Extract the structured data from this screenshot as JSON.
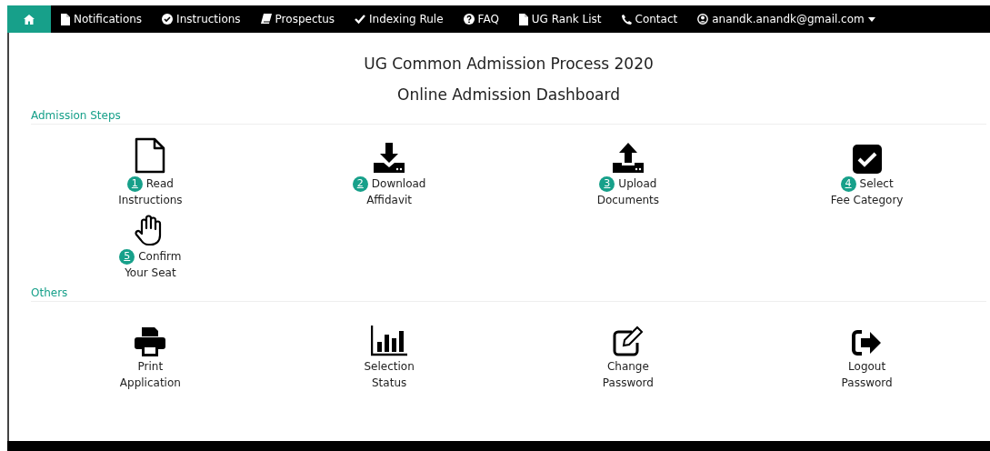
{
  "nav": {
    "items": [
      {
        "kind": "home",
        "selected": true
      },
      {
        "kind": "file",
        "label": "Notifications",
        "selected": false
      },
      {
        "kind": "check-circle",
        "label": "Instructions",
        "selected": false
      },
      {
        "kind": "book",
        "label": "Prospectus",
        "selected": false
      },
      {
        "kind": "check",
        "label": "Indexing Rule",
        "selected": false
      },
      {
        "kind": "question",
        "label": "FAQ",
        "selected": false
      },
      {
        "kind": "file",
        "label": "UG Rank List",
        "selected": false
      },
      {
        "kind": "phone",
        "label": "Contact",
        "selected": false
      }
    ],
    "user": {
      "label": "anandk.anandk@gmail.com"
    }
  },
  "titles": [
    "UG Common Admission Process 2020",
    "Online Admission Dashboard"
  ],
  "sections": [
    {
      "heading": "Admission Steps",
      "items": [
        {
          "kind": "file",
          "number": "1",
          "line1": "Read",
          "line2": "Instructions"
        },
        {
          "kind": "download",
          "number": "2",
          "line1": "Download",
          "line2": "Affidavit"
        },
        {
          "kind": "upload",
          "number": "3",
          "line1": "Upload",
          "line2": "Documents"
        },
        {
          "kind": "checkbox",
          "number": "4",
          "line1": "Select",
          "line2": "Fee Category"
        },
        {
          "kind": "hand",
          "number": "5",
          "line1": "Confirm",
          "line2": "Your Seat"
        }
      ]
    },
    {
      "heading": "Others",
      "items": [
        {
          "kind": "print",
          "line1": "Print",
          "line2": "Application"
        },
        {
          "kind": "bars",
          "line1": "Selection",
          "line2": "Status"
        },
        {
          "kind": "edit",
          "line1": "Change",
          "line2": "Password"
        },
        {
          "kind": "logout",
          "line1": "Logout",
          "line2": "Password"
        }
      ]
    }
  ]
}
